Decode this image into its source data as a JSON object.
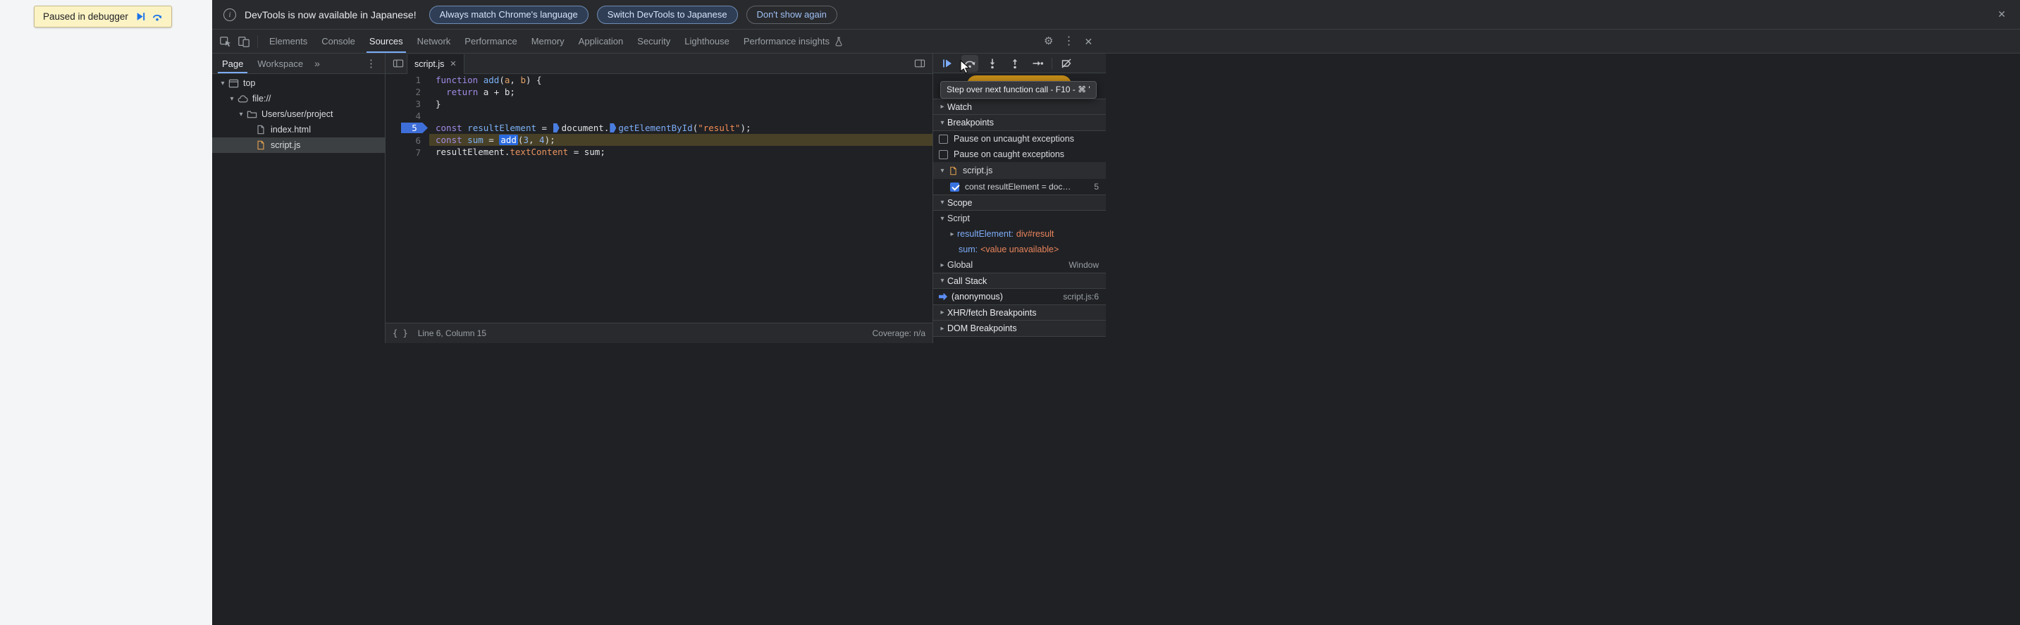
{
  "glyphs": {
    "close": "✕",
    "gear": "⚙",
    "more_v": "⋮",
    "chevron_right": "▸",
    "chevron_down": "▾",
    "more_tabs": "»",
    "pretty_print": "{ }",
    "info": "i"
  },
  "page": {
    "paused_label": "Paused in debugger"
  },
  "infobar": {
    "message": "DevTools is now available in Japanese!",
    "button_match": "Always match Chrome's language",
    "button_switch": "Switch DevTools to Japanese",
    "button_dismiss": "Don't show again"
  },
  "toolbar": {
    "selected": "Sources",
    "tabs": [
      {
        "label": "Elements"
      },
      {
        "label": "Console"
      },
      {
        "label": "Sources"
      },
      {
        "label": "Network"
      },
      {
        "label": "Performance"
      },
      {
        "label": "Memory"
      },
      {
        "label": "Application"
      },
      {
        "label": "Security"
      },
      {
        "label": "Lighthouse"
      },
      {
        "label": "Performance insights",
        "flask": true
      }
    ]
  },
  "navigator": {
    "tab_page": "Page",
    "tab_workspace": "Workspace",
    "tree": [
      {
        "label": "top",
        "depth": 0,
        "icon": "frame",
        "expanded": true
      },
      {
        "label": "file://",
        "depth": 1,
        "icon": "cloud",
        "expanded": true
      },
      {
        "label": "Users/user/project",
        "depth": 2,
        "icon": "folder",
        "expanded": true
      },
      {
        "label": "index.html",
        "depth": 3,
        "icon": "file"
      },
      {
        "label": "script.js",
        "depth": 3,
        "icon": "file-js",
        "selected": true
      }
    ]
  },
  "editor": {
    "tab": "script.js",
    "status_position": "Line 6, Column 15",
    "coverage": "Coverage: n/a",
    "lines": [
      {
        "num": 1,
        "tokens": [
          {
            "t": "function",
            "c": "kw"
          },
          {
            "t": " ",
            "c": "pl"
          },
          {
            "t": "add",
            "c": "fn"
          },
          {
            "t": "(",
            "c": "pl"
          },
          {
            "t": "a",
            "c": "param"
          },
          {
            "t": ", ",
            "c": "pl"
          },
          {
            "t": "b",
            "c": "param"
          },
          {
            "t": ") {",
            "c": "pl"
          }
        ]
      },
      {
        "num": 2,
        "tokens": [
          {
            "t": "  ",
            "c": "pl"
          },
          {
            "t": "return",
            "c": "kw"
          },
          {
            "t": " a + b;",
            "c": "pl"
          }
        ]
      },
      {
        "num": 3,
        "tokens": [
          {
            "t": "}",
            "c": "pl"
          }
        ]
      },
      {
        "num": 4,
        "tokens": []
      },
      {
        "num": 5,
        "breakpoint": true,
        "tokens": [
          {
            "t": "const",
            "c": "kw"
          },
          {
            "t": " ",
            "c": "pl"
          },
          {
            "t": "resultElement",
            "c": "def"
          },
          {
            "t": " = ",
            "c": "pl"
          },
          {
            "marker": true
          },
          {
            "t": "document",
            "c": "pl"
          },
          {
            "t": ".",
            "c": "pl"
          },
          {
            "marker": true
          },
          {
            "t": "getElementById",
            "c": "propb"
          },
          {
            "t": "(",
            "c": "pl"
          },
          {
            "t": "\"result\"",
            "c": "str"
          },
          {
            "t": ");",
            "c": "pl"
          }
        ]
      },
      {
        "num": 6,
        "exec": true,
        "tokens": [
          {
            "t": "const",
            "c": "kw"
          },
          {
            "t": " ",
            "c": "pl"
          },
          {
            "t": "sum",
            "c": "def"
          },
          {
            "t": " = ",
            "c": "pl"
          },
          {
            "t": "add",
            "c": "callhl"
          },
          {
            "t": "(",
            "c": "pl"
          },
          {
            "t": "3",
            "c": "num"
          },
          {
            "t": ", ",
            "c": "pl"
          },
          {
            "t": "4",
            "c": "num"
          },
          {
            "t": ");",
            "c": "pl"
          }
        ]
      },
      {
        "num": 7,
        "tokens": [
          {
            "t": "resultElement",
            "c": "pl"
          },
          {
            "t": ".",
            "c": "pl"
          },
          {
            "t": "textContent",
            "c": "propo"
          },
          {
            "t": " = sum;",
            "c": "pl"
          }
        ]
      }
    ]
  },
  "debugger": {
    "tooltip": "Step over next function call - F10 - ⌘ '",
    "watch_label": "Watch",
    "breakpoints_label": "Breakpoints",
    "pause_uncaught": "Pause on uncaught exceptions",
    "pause_caught": "Pause on caught exceptions",
    "bp_file": "script.js",
    "bp_entry_text": "const resultElement = doc…",
    "bp_entry_line": "5",
    "scope_label": "Scope",
    "scope_script_label": "Script",
    "var1_name": "resultElement:",
    "var1_value": "div#result",
    "var2_name": "sum:",
    "var2_value": "<value unavailable>",
    "global_label": "Global",
    "global_value": "Window",
    "callstack_label": "Call Stack",
    "frame_name": "(anonymous)",
    "frame_location": "script.js:6",
    "xhr_label": "XHR/fetch Breakpoints",
    "dom_label": "DOM Breakpoints"
  }
}
